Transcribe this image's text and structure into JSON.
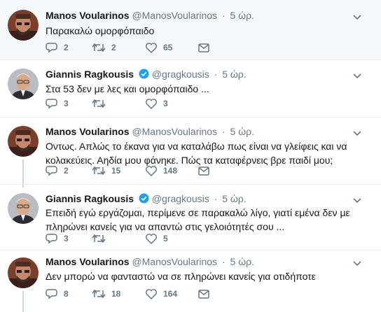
{
  "tweets": [
    {
      "name": "Manos Voularinos",
      "handle": "@ManosVoularinos",
      "time": "5 ώρ.",
      "verified": false,
      "text": "Παρακαλώ ομορφόπαιδο",
      "replies": "2",
      "retweets": "2",
      "likes": "65"
    },
    {
      "name": "Giannis Ragkousis",
      "handle": "@gragkousis",
      "time": "5 ώρ.",
      "verified": true,
      "text": "Στα 53 δεν με λες και ομορφόπαιδο ...",
      "replies": "3",
      "retweets": "",
      "likes": "3"
    },
    {
      "name": "Manos Voularinos",
      "handle": "@ManosVoularinos",
      "time": "5 ώρ.",
      "verified": false,
      "text_line1": "Οντως. Απλώς το έκανα για να καταλάβω πως είναι να γλείφεις και να",
      "text_line2": "κολακεύεις. Αηδία μου φάνηκε. Πώς τα καταφέρνεις βρε παιδί μου;",
      "replies": "2",
      "retweets": "15",
      "likes": "148"
    },
    {
      "name": "Giannis Ragkousis",
      "handle": "@gragkousis",
      "time": "5 ώρ.",
      "verified": true,
      "text_line1": "Επειδή εγώ εργάζομαι, περίμενε σε παρακαλώ λίγο, γιατί εμένα δεν με",
      "text_line2": "πληρώνει κανείς για να απαντώ στις γελοιότητές σου ...",
      "replies": "3",
      "retweets": "",
      "likes": "5"
    },
    {
      "name": "Manos Voularinos",
      "handle": "@ManosVoularinos",
      "time": "5 ώρ.",
      "verified": false,
      "text": "Δεν μπορώ να φανταστώ να σε πληρώνει κανείς για οτιδήποτε",
      "replies": "8",
      "retweets": "18",
      "likes": "164"
    }
  ],
  "colors": {
    "text": "#14171a",
    "secondary": "#657786",
    "thread_line": "#ccd6dd",
    "verified": "#1da1f2",
    "first_bg": "#f5f8fa"
  },
  "icons": [
    "reply-icon",
    "retweet-icon",
    "like-icon",
    "message-icon",
    "chevron-down-icon",
    "verified-badge-icon"
  ]
}
